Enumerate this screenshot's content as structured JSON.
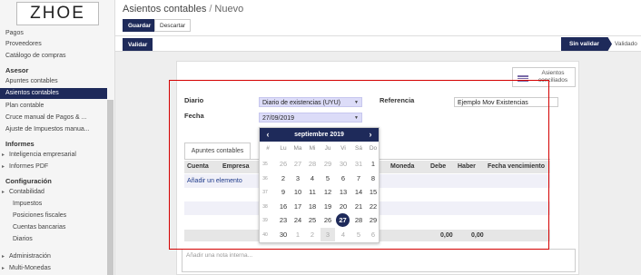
{
  "sidebar": {
    "logo": "ZHOE",
    "items": [
      {
        "label": "Pagos",
        "type": "item"
      },
      {
        "label": "Proveedores",
        "type": "item"
      },
      {
        "label": "Catálogo de compras",
        "type": "item"
      },
      {
        "label": "Asesor",
        "type": "section"
      },
      {
        "label": "Apuntes contables",
        "type": "item"
      },
      {
        "label": "Asientos contables",
        "type": "item",
        "active": true
      },
      {
        "label": "Plan contable",
        "type": "item"
      },
      {
        "label": "Cruce manual de Pagos & ...",
        "type": "item"
      },
      {
        "label": "Ajuste de Impuestos manua...",
        "type": "item"
      },
      {
        "label": "Informes",
        "type": "section"
      },
      {
        "label": "Inteligencia empresarial",
        "type": "item",
        "caret": true
      },
      {
        "label": "Informes PDF",
        "type": "item",
        "caret": true
      },
      {
        "label": "Configuración",
        "type": "section"
      },
      {
        "label": "Contabilidad",
        "type": "item",
        "caret": true
      },
      {
        "label": "Impuestos",
        "type": "sub"
      },
      {
        "label": "Posiciones fiscales",
        "type": "sub"
      },
      {
        "label": "Cuentas bancarias",
        "type": "sub"
      },
      {
        "label": "Diarios",
        "type": "sub"
      },
      {
        "label": "Administración",
        "type": "item",
        "caret": true
      },
      {
        "label": "Multi-Monedas",
        "type": "item",
        "caret": true
      }
    ]
  },
  "header": {
    "breadcrumb": "Asientos contables",
    "separator": "/",
    "current": "Nuevo",
    "save_label": "Guardar",
    "discard_label": "Descartar",
    "validate_label": "Validar",
    "status_active": "Sin validar",
    "status_inactive": "Validado"
  },
  "form": {
    "smart_button": "Asientos conciliados",
    "journal_label": "Diario",
    "journal_value": "Diario de existencias (UYU)",
    "date_label": "Fecha",
    "date_value": "27/09/2019",
    "reference_label": "Referencia",
    "reference_value": "Ejemplo Mov Existencias"
  },
  "tab": {
    "label": "Apuntes contables"
  },
  "table": {
    "columns": [
      "Cuenta",
      "Empresa",
      "Moneda",
      "Debe",
      "Haber",
      "Fecha vencimiento"
    ],
    "add_line": "Añadir un elemento",
    "total_debit": "0,00",
    "total_credit": "0,00"
  },
  "note_placeholder": "Añadir una nota interna...",
  "datepicker": {
    "prev": "‹",
    "next": "›",
    "month": "septiembre 2019",
    "weekday_header_week": "#",
    "weekdays": [
      "Lu",
      "Ma",
      "Mi",
      "Ju",
      "Vi",
      "Sá",
      "Do"
    ],
    "weeks": [
      {
        "num": "35",
        "days": [
          "26",
          "27",
          "28",
          "29",
          "30",
          "31",
          "1"
        ]
      },
      {
        "num": "36",
        "days": [
          "2",
          "3",
          "4",
          "5",
          "6",
          "7",
          "8"
        ]
      },
      {
        "num": "37",
        "days": [
          "9",
          "10",
          "11",
          "12",
          "13",
          "14",
          "15"
        ]
      },
      {
        "num": "38",
        "days": [
          "16",
          "17",
          "18",
          "19",
          "20",
          "21",
          "22"
        ]
      },
      {
        "num": "39",
        "days": [
          "23",
          "24",
          "25",
          "26",
          "27",
          "28",
          "29"
        ]
      },
      {
        "num": "40",
        "days": [
          "30",
          "1",
          "2",
          "3",
          "4",
          "5",
          "6"
        ]
      }
    ],
    "selected": "27"
  },
  "colors": {
    "primary": "#1e2a5a",
    "annotation": "#d40000",
    "field_bg": "#dcdcf8"
  }
}
